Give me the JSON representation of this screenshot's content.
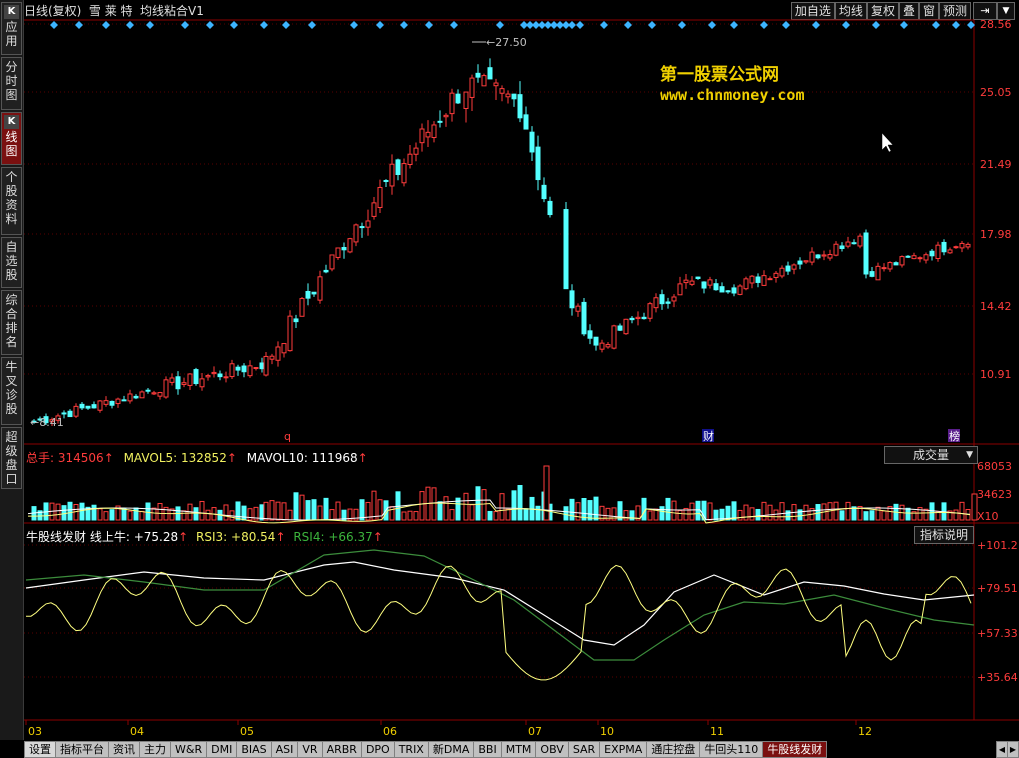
{
  "header": {
    "period": "日线(复权)",
    "stock_name": "雪 莱 特",
    "indicator": "均线粘合V1"
  },
  "toolbar": [
    "加自选",
    "均线",
    "复权",
    "叠",
    "窗",
    "预测"
  ],
  "sidebar": [
    {
      "k": "K",
      "label": "应用"
    },
    {
      "k": "",
      "label": "分时图"
    },
    {
      "k": "K",
      "label": "线图",
      "active": true
    },
    {
      "k": "",
      "label": "个股资料"
    },
    {
      "k": "",
      "label": "自选股"
    },
    {
      "k": "",
      "label": "综合排名"
    },
    {
      "k": "",
      "label": "牛叉诊股"
    },
    {
      "k": "",
      "label": "超级盘口"
    }
  ],
  "watermark": {
    "line1": "第一股票公式网",
    "line2": "www.chnmoney.com"
  },
  "price_axis": [
    "28.56",
    "25.05",
    "21.49",
    "17.98",
    "14.42",
    "10.91"
  ],
  "markers": {
    "high": "27.50",
    "low": "8.41",
    "q": "q",
    "cai": "财",
    "bang": "榜"
  },
  "volume": {
    "total_label": "总手:",
    "total": "314506",
    "mavol5_label": "MAVOL5:",
    "mavol5": "132852",
    "mavol10_label": "MAVOL10:",
    "mavol10": "111968",
    "dropdown": "成交量",
    "axis": [
      "68053",
      "34623",
      "X10"
    ]
  },
  "indicator_panel": {
    "name": "牛股线发财",
    "line_label": "线上牛:",
    "line_val": "+75.28",
    "rsi3_label": "RSI3:",
    "rsi3_val": "+80.54",
    "rsi4_label": "RSI4:",
    "rsi4_val": "+66.37",
    "dropdown": "指标说明",
    "axis": [
      "+101.2",
      "+79.51",
      "+57.33",
      "+35.64"
    ]
  },
  "x_months": [
    "03",
    "04",
    "05",
    "06",
    "07",
    "10",
    "11",
    "12"
  ],
  "bottom_tabs": [
    "设置",
    "指标平台",
    "资讯",
    "主力",
    "W&R",
    "DMI",
    "BIAS",
    "ASI",
    "VR",
    "ARBR",
    "DPO",
    "TRIX",
    "新DMA",
    "BBI",
    "MTM",
    "OBV",
    "SAR",
    "EXPMA",
    "通庄控盘",
    "牛回头110",
    "牛股线发财"
  ],
  "colors": {
    "up": "#ff3c3c",
    "down": "#54ffff",
    "grid": "#5a0000",
    "axis_text": "#ff3c3c",
    "diamond": "#3cb4ff",
    "white_line": "#ffffff",
    "yellow_line": "#ffff80",
    "green_line": "#3c8c3c"
  }
}
